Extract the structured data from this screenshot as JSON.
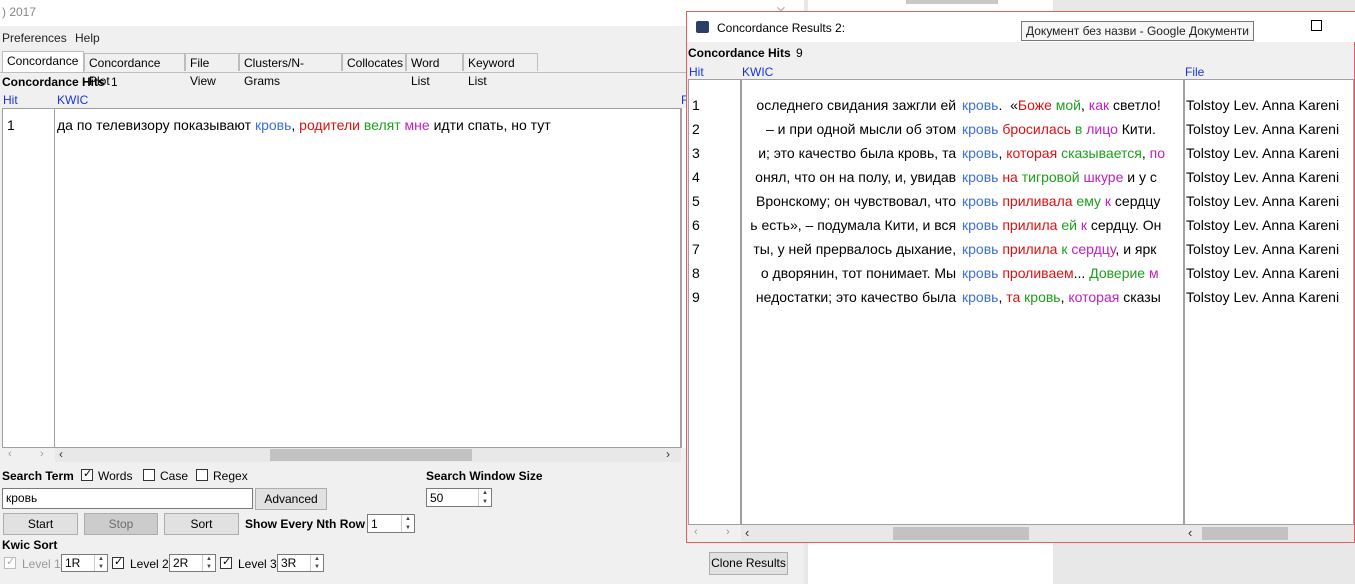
{
  "main": {
    "title": ") 2017",
    "menu": [
      "Preferences",
      "Help"
    ],
    "tabs": [
      "Concordance",
      "Concordance Plot",
      "File View",
      "Clusters/N-Grams",
      "Collocates",
      "Word List",
      "Keyword List"
    ],
    "hits_label": "Concordance Hits",
    "hits_count": "1",
    "col_hit": "Hit",
    "col_kwic": "KWIC",
    "row_num": "1",
    "kwic_row": [
      {
        "text": "да по телевизору показывают ",
        "color": "#000000"
      },
      {
        "text": "кровь",
        "color": "#3a6fe0"
      },
      {
        "text": ", ",
        "color": "#000000"
      },
      {
        "text": "родители",
        "color": "#e01010"
      },
      {
        "text": " ",
        "color": "#000000"
      },
      {
        "text": "велят",
        "color": "#1ea01e"
      },
      {
        "text": " ",
        "color": "#000000"
      },
      {
        "text": "мне",
        "color": "#c020c0"
      },
      {
        "text": " идти спать, но тут",
        "color": "#000000"
      }
    ],
    "search_term_label": "Search Term",
    "words_label": "Words",
    "case_label": "Case",
    "regex_label": "Regex",
    "search_value": "кровь",
    "advanced_label": "Advanced",
    "search_window_label": "Search Window Size",
    "search_window_value": "50",
    "start_label": "Start",
    "stop_label": "Stop",
    "sort_label": "Sort",
    "nth_row_label": "Show Every Nth Row",
    "nth_row_value": "1",
    "kwic_sort_label": "Kwic Sort",
    "level1_label": "Level 1",
    "level1_value": "1R",
    "level2_label": "Level 2",
    "level2_value": "2R",
    "level3_label": "Level 3",
    "level3_value": "3R",
    "clone_label": "Clone Results"
  },
  "results_window": {
    "title": "Concordance Results 2:",
    "hits_label": "Concordance Hits",
    "hits_count": "9",
    "col_hit": "Hit",
    "col_kwic": "KWIC",
    "col_file": "File",
    "tooltip": "Документ без назви - Google Документи",
    "rows": [
      {
        "n": "1",
        "left": "оследнего свидания зажгли ей ",
        "parts": [
          {
            "t": "кровь",
            "c": "blue"
          },
          {
            "t": ".  «",
            "c": "black"
          },
          {
            "t": "Боже",
            "c": "red"
          },
          {
            "t": " ",
            "c": "black"
          },
          {
            "t": "мой",
            "c": "green"
          },
          {
            "t": ", ",
            "c": "black"
          },
          {
            "t": "как",
            "c": "purple"
          },
          {
            "t": " светло! ",
            "c": "black"
          }
        ],
        "file": "Tolstoy Lev. Anna Kareni"
      },
      {
        "n": "2",
        "left": " – и при одной мысли об этом ",
        "parts": [
          {
            "t": "кровь",
            "c": "blue"
          },
          {
            "t": " ",
            "c": "black"
          },
          {
            "t": "бросилась",
            "c": "red"
          },
          {
            "t": " ",
            "c": "black"
          },
          {
            "t": "в",
            "c": "green"
          },
          {
            "t": " ",
            "c": "black"
          },
          {
            "t": "лицо",
            "c": "purple"
          },
          {
            "t": " Кити.",
            "c": "black"
          }
        ],
        "file": "Tolstoy Lev. Anna Kareni"
      },
      {
        "n": "3",
        "left": "и; это качество была кровь, та ",
        "parts": [
          {
            "t": "кровь",
            "c": "blue"
          },
          {
            "t": ", ",
            "c": "black"
          },
          {
            "t": "которая",
            "c": "red"
          },
          {
            "t": " ",
            "c": "black"
          },
          {
            "t": "сказывается",
            "c": "green"
          },
          {
            "t": ", ",
            "c": "black"
          },
          {
            "t": "по",
            "c": "purple"
          }
        ],
        "file": "Tolstoy Lev. Anna Kareni"
      },
      {
        "n": "4",
        "left": "онял, что он на полу, и, увидав ",
        "parts": [
          {
            "t": "кровь",
            "c": "blue"
          },
          {
            "t": " ",
            "c": "black"
          },
          {
            "t": "на",
            "c": "red"
          },
          {
            "t": " ",
            "c": "black"
          },
          {
            "t": "тигровой",
            "c": "green"
          },
          {
            "t": " ",
            "c": "black"
          },
          {
            "t": "шкуре",
            "c": "purple"
          },
          {
            "t": " и у с",
            "c": "black"
          }
        ],
        "file": "Tolstoy Lev. Anna Kareni"
      },
      {
        "n": "5",
        "left": "Вронскому; он чувствовал, что ",
        "parts": [
          {
            "t": "кровь",
            "c": "blue"
          },
          {
            "t": " ",
            "c": "black"
          },
          {
            "t": "приливала",
            "c": "red"
          },
          {
            "t": " ",
            "c": "black"
          },
          {
            "t": "ему",
            "c": "green"
          },
          {
            "t": " ",
            "c": "black"
          },
          {
            "t": "к",
            "c": "purple"
          },
          {
            "t": " сердцу",
            "c": "black"
          }
        ],
        "file": "Tolstoy Lev. Anna Kareni"
      },
      {
        "n": "6",
        "left": "ь есть», – подумала Кити, и вся ",
        "parts": [
          {
            "t": "кровь",
            "c": "blue"
          },
          {
            "t": " ",
            "c": "black"
          },
          {
            "t": "прилила",
            "c": "red"
          },
          {
            "t": " ",
            "c": "black"
          },
          {
            "t": "ей",
            "c": "green"
          },
          {
            "t": " ",
            "c": "black"
          },
          {
            "t": "к",
            "c": "purple"
          },
          {
            "t": " сердцу. Он",
            "c": "black"
          }
        ],
        "file": "Tolstoy Lev. Anna Kareni"
      },
      {
        "n": "7",
        "left": "ты, у ней прервалось дыхание, ",
        "parts": [
          {
            "t": "кровь",
            "c": "blue"
          },
          {
            "t": " ",
            "c": "black"
          },
          {
            "t": "прилила",
            "c": "red"
          },
          {
            "t": " ",
            "c": "black"
          },
          {
            "t": "к",
            "c": "green"
          },
          {
            "t": " ",
            "c": "black"
          },
          {
            "t": "сердцу",
            "c": "purple"
          },
          {
            "t": ", и ярк",
            "c": "black"
          }
        ],
        "file": "Tolstoy Lev. Anna Kareni"
      },
      {
        "n": "8",
        "left": "о дворянин, тот понимает. Мы ",
        "parts": [
          {
            "t": "кровь",
            "c": "blue"
          },
          {
            "t": " ",
            "c": "black"
          },
          {
            "t": "проливаем",
            "c": "red"
          },
          {
            "t": "... ",
            "c": "black"
          },
          {
            "t": "Доверие",
            "c": "green"
          },
          {
            "t": " ",
            "c": "black"
          },
          {
            "t": "м",
            "c": "purple"
          }
        ],
        "file": "Tolstoy Lev. Anna Kareni"
      },
      {
        "n": "9",
        "left": "недостатки; это качество была ",
        "parts": [
          {
            "t": "кровь",
            "c": "blue"
          },
          {
            "t": ", ",
            "c": "black"
          },
          {
            "t": "та",
            "c": "red"
          },
          {
            "t": " ",
            "c": "black"
          },
          {
            "t": "кровь",
            "c": "green"
          },
          {
            "t": ", ",
            "c": "black"
          },
          {
            "t": "которая",
            "c": "purple"
          },
          {
            "t": " сказы",
            "c": "black"
          }
        ],
        "file": "Tolstoy Lev. Anna Kareni"
      }
    ]
  },
  "colors": {
    "blue": "#3a6fe0",
    "red": "#e01010",
    "green": "#1ea01e",
    "purple": "#c020c0",
    "black": "#000000",
    "header_blue": "#1a35d8"
  },
  "icons": [
    "minimize-icon",
    "maximize-icon",
    "close-icon",
    "app-icon",
    "checkmark-icon",
    "chevron-left-icon",
    "chevron-right-icon",
    "spin-up-icon",
    "spin-down-icon"
  ]
}
